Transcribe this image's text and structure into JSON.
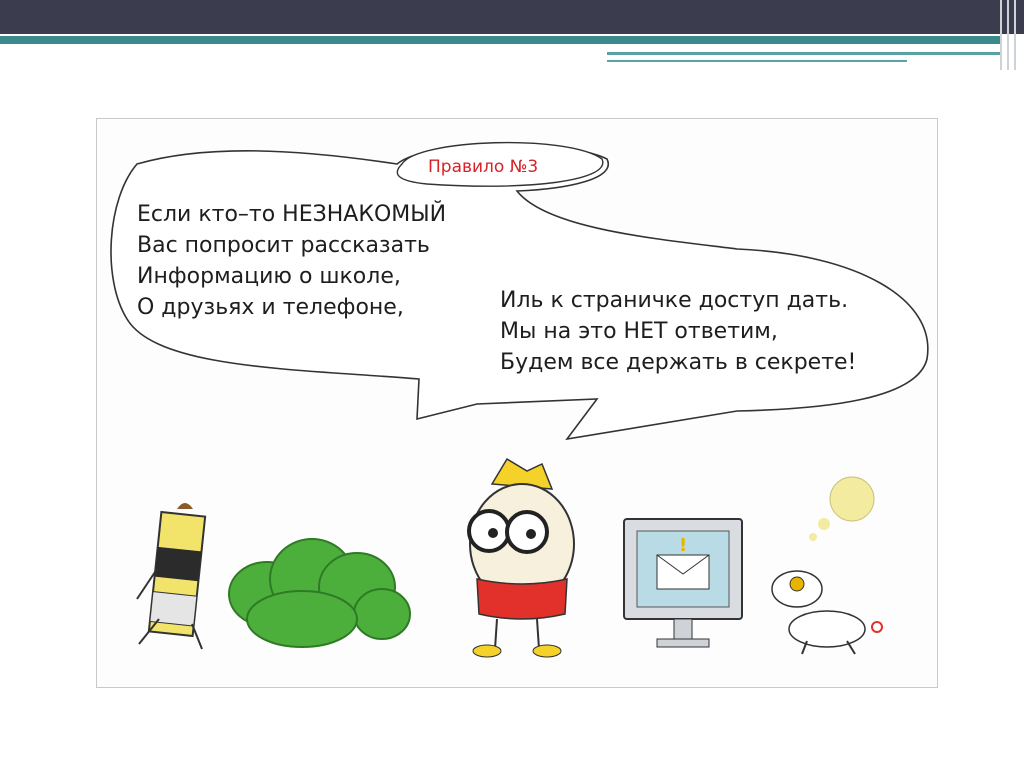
{
  "slide": {
    "rule_title": "Правило №3",
    "left_verse": [
      "Если кто–то НЕЗНАКОМЫЙ",
      "Вас попросит рассказать",
      "Информацию о школе,",
      "О друзьях и телефоне,"
    ],
    "right_verse": [
      "Иль к страничке доступ дать.",
      "Мы на это НЕТ ответим,",
      "Будем все держать в секрете!"
    ]
  },
  "colors": {
    "header_dark": "#3b3d4f",
    "header_teal": "#3d8a8c",
    "rule_title": "#d8222a",
    "text": "#1e1e1e",
    "bush": "#4caf3c",
    "boy_shirt": "#e2302b",
    "boy_hair": "#f5d22a"
  },
  "illustration": {
    "characters": [
      "battery-icon",
      "bush-icon",
      "boy-with-glasses-icon",
      "computer-monitor-icon",
      "dog-icon"
    ]
  }
}
